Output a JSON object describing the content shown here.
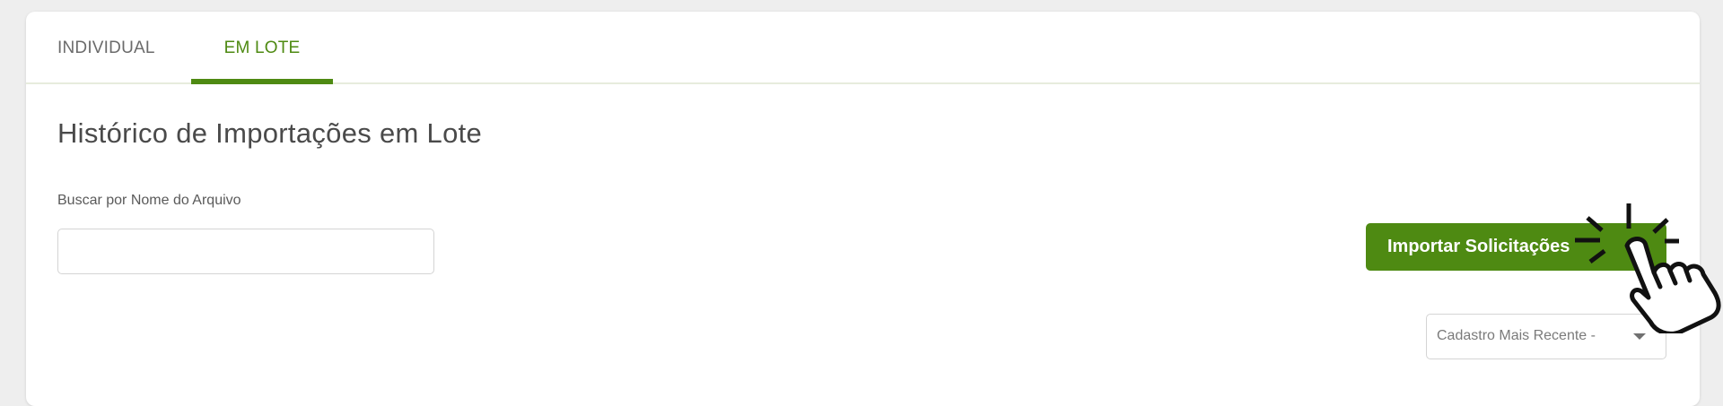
{
  "tabs": {
    "individual": "INDIVIDUAL",
    "lote": "EM LOTE",
    "active": "EM LOTE"
  },
  "page": {
    "title": "Histórico de Importações em Lote"
  },
  "search": {
    "label": "Buscar por Nome do Arquivo",
    "value": "",
    "placeholder": ""
  },
  "actions": {
    "import_label": "Importar Solicitações"
  },
  "sort": {
    "selected": "Cadastro Mais Recente - "
  },
  "colors": {
    "accent": "#4e8a12",
    "background": "#eeeeee",
    "card": "#ffffff"
  },
  "icons": {
    "cursor": "click-hand-icon",
    "dropdown": "caret-down-icon"
  }
}
